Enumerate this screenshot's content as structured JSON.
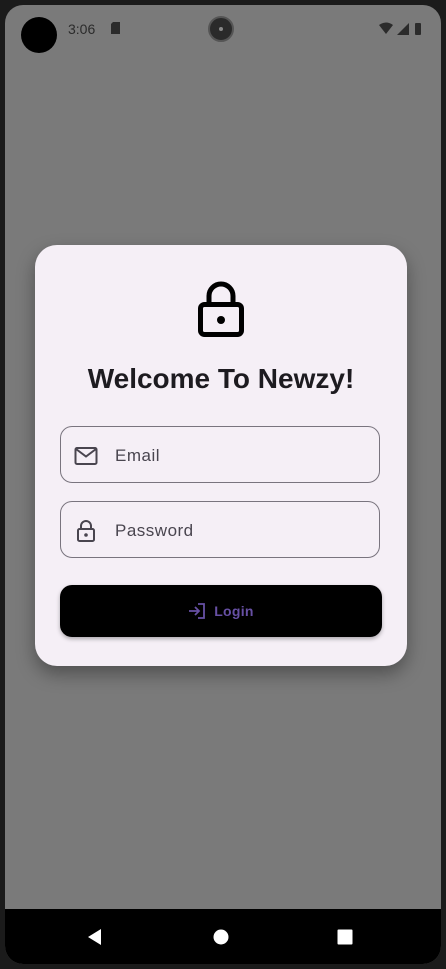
{
  "status_bar": {
    "time": "3:06"
  },
  "login_card": {
    "title": "Welcome To Newzy!",
    "email_placeholder": "Email",
    "password_placeholder": "Password",
    "login_label": "Login"
  },
  "colors": {
    "scrim": "#7a7a7a",
    "card": "#f5eff6",
    "button": "#000000",
    "button_text": "#6750a4",
    "outline": "#79747e"
  },
  "icons": [
    "lock-icon",
    "mail-icon",
    "lock-icon",
    "login-icon",
    "back-icon",
    "home-icon",
    "recents-icon"
  ]
}
